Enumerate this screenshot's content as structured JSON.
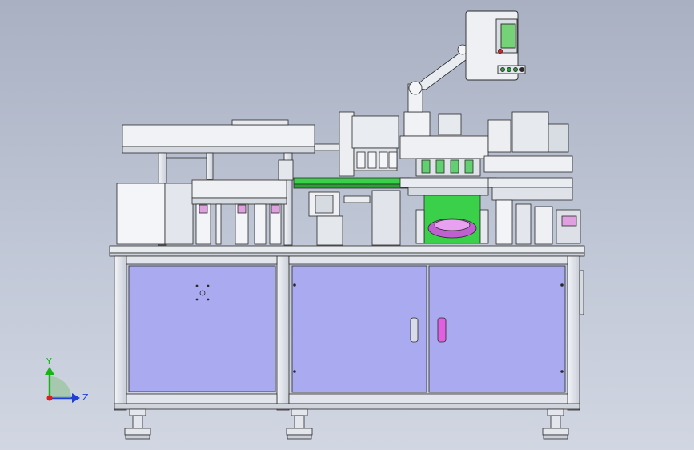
{
  "view": {
    "background_top": "#a9b0c2",
    "background_bottom": "#d1d6e2"
  },
  "machine": {
    "frame_color": "#dfe3ea",
    "panel_color": "#aaaaf0",
    "outline_color": "#2a2a2a",
    "green_color": "#3bd04a",
    "magenta_color": "#e060e0",
    "screen_color": "#76d276"
  },
  "axis_triad": {
    "y_label": "Y",
    "z_label": "Z",
    "y_color": "#19b319",
    "z_color": "#1f3fd8",
    "origin_color": "#d81f1f"
  }
}
